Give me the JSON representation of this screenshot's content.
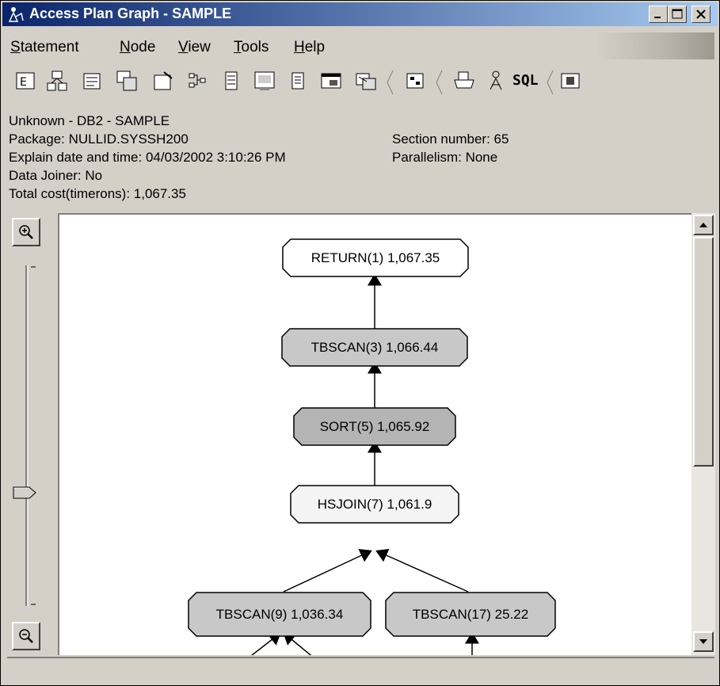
{
  "window": {
    "title": "Access Plan Graph - SAMPLE"
  },
  "menu": {
    "items": [
      {
        "label": "Statement",
        "accel": "S",
        "rest": "tatement"
      },
      {
        "label": "Node",
        "accel": "N",
        "rest": "ode"
      },
      {
        "label": "View",
        "accel": "V",
        "rest": "iew"
      },
      {
        "label": "Tools",
        "accel": "T",
        "rest": "ools"
      },
      {
        "label": "Help",
        "accel": "H",
        "rest": "elp"
      }
    ]
  },
  "toolbar": {
    "sql_label": "SQL"
  },
  "info": {
    "line1": "Unknown - DB2 - SAMPLE",
    "package": "Package: NULLID.SYSSH200",
    "explain": "Explain date and time: 04/03/2002 3:10:26 PM",
    "joiner": "Data Joiner: No",
    "cost": "Total cost(timerons): 1,067.35",
    "section": "Section number: 65",
    "parallelism": "Parallelism: None"
  },
  "graph": {
    "nodes": [
      {
        "id": "return1",
        "label": "RETURN(1) 1,067.35"
      },
      {
        "id": "tbscan3",
        "label": "TBSCAN(3) 1,066.44"
      },
      {
        "id": "sort5",
        "label": "SORT(5) 1,065.92"
      },
      {
        "id": "hsjoin7",
        "label": "HSJOIN(7) 1,061.9"
      },
      {
        "id": "tbscan9",
        "label": "TBSCAN(9) 1,036.34"
      },
      {
        "id": "tbscan17",
        "label": "TBSCAN(17) 25.22"
      }
    ]
  },
  "colors": {
    "titlebar_start": "#0a246a",
    "titlebar_end": "#a6caf0",
    "node_white": "#ffffff",
    "node_light": "#f4f4f4",
    "node_gray": "#c8c8c8",
    "node_darkgray": "#b4b4b4"
  },
  "icons": [
    "app-icon",
    "minimize-icon",
    "maximize-icon",
    "close-icon",
    "zoom-in-icon",
    "zoom-out-icon",
    "print-icon",
    "scroll-up-icon",
    "scroll-down-icon"
  ]
}
